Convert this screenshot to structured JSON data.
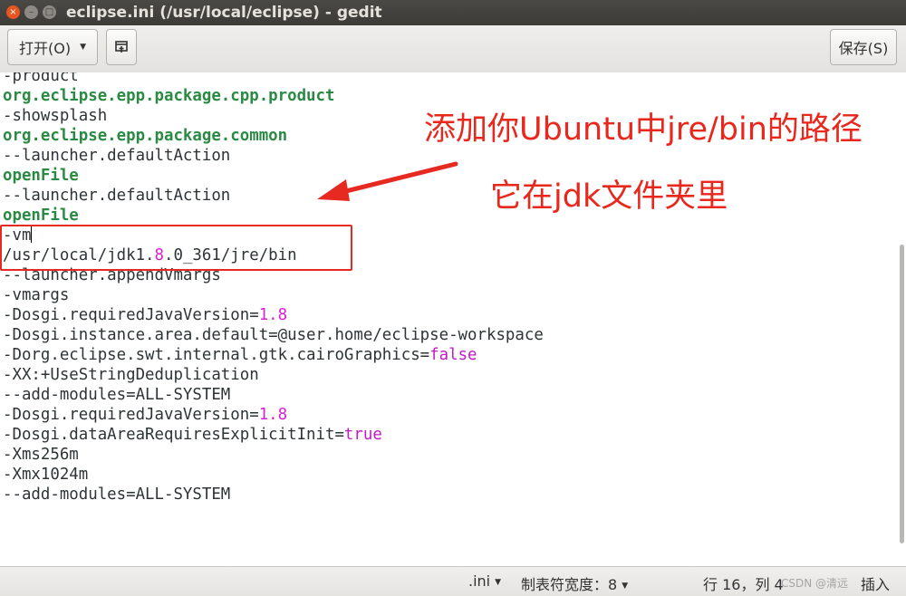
{
  "window": {
    "title": "eclipse.ini (/usr/local/eclipse) - gedit",
    "close_glyph": "×",
    "minimize_glyph": "–",
    "maximize_glyph": "□"
  },
  "toolbar": {
    "open_label": "打开(O)",
    "pin_glyph": "⌂",
    "save_label": "保存(S)"
  },
  "editor": {
    "lines": [
      [
        {
          "t": "-product"
        }
      ],
      [
        {
          "t": "org.eclipse.epp.package.cpp.product",
          "c": "b"
        }
      ],
      [
        {
          "t": "-showsplash"
        }
      ],
      [
        {
          "t": "org.eclipse.epp.package.common",
          "c": "b"
        }
      ],
      [
        {
          "t": "--launcher.defaultAction"
        }
      ],
      [
        {
          "t": "openFile",
          "c": "b"
        }
      ],
      [
        {
          "t": "--launcher.defaultAction"
        }
      ],
      [
        {
          "t": "openFile",
          "c": "b"
        }
      ],
      [
        {
          "t": "-vm"
        }
      ],
      [
        {
          "t": "/usr/local/jdk1."
        },
        {
          "t": "8",
          "c": "num"
        },
        {
          "t": ".0_361/jre/bin"
        }
      ],
      [
        {
          "t": "--launcher.appendVmargs"
        }
      ],
      [
        {
          "t": "-vmargs"
        }
      ],
      [
        {
          "t": "-Dosgi.requiredJavaVersion="
        },
        {
          "t": "1.8",
          "c": "num"
        }
      ],
      [
        {
          "t": "-Dosgi.instance.area.default=@user.home/eclipse-workspace"
        }
      ],
      [
        {
          "t": "-Dorg.eclipse.swt.internal.gtk.cairoGraphics="
        },
        {
          "t": "false",
          "c": "kw"
        }
      ],
      [
        {
          "t": "-XX:+UseStringDeduplication"
        }
      ],
      [
        {
          "t": "--add-modules=ALL-SYSTEM"
        }
      ],
      [
        {
          "t": "-Dosgi.requiredJavaVersion="
        },
        {
          "t": "1.8",
          "c": "num"
        }
      ],
      [
        {
          "t": "-Dosgi.dataAreaRequiresExplicitInit="
        },
        {
          "t": "true",
          "c": "kw"
        }
      ],
      [
        {
          "t": "-Xms256m"
        }
      ],
      [
        {
          "t": "-Xmx1024m"
        }
      ],
      [
        {
          "t": "--add-modules=ALL-SYSTEM"
        }
      ]
    ],
    "caret_line": 8,
    "colors": {
      "bold_token": "#2a8a43",
      "number": "#d91ed6",
      "keyword": "#c21bc6"
    }
  },
  "annotation": {
    "note_line1": "添加你Ubuntu中jre/bin的路径",
    "note_line2": "它在jdk文件夹里",
    "color": "#e8271d"
  },
  "statusbar": {
    "language": ".ini",
    "tab_width": "制表符宽度：8",
    "position": "行 16，列 4",
    "mode": "插入",
    "watermark": "CSDN @清远"
  }
}
